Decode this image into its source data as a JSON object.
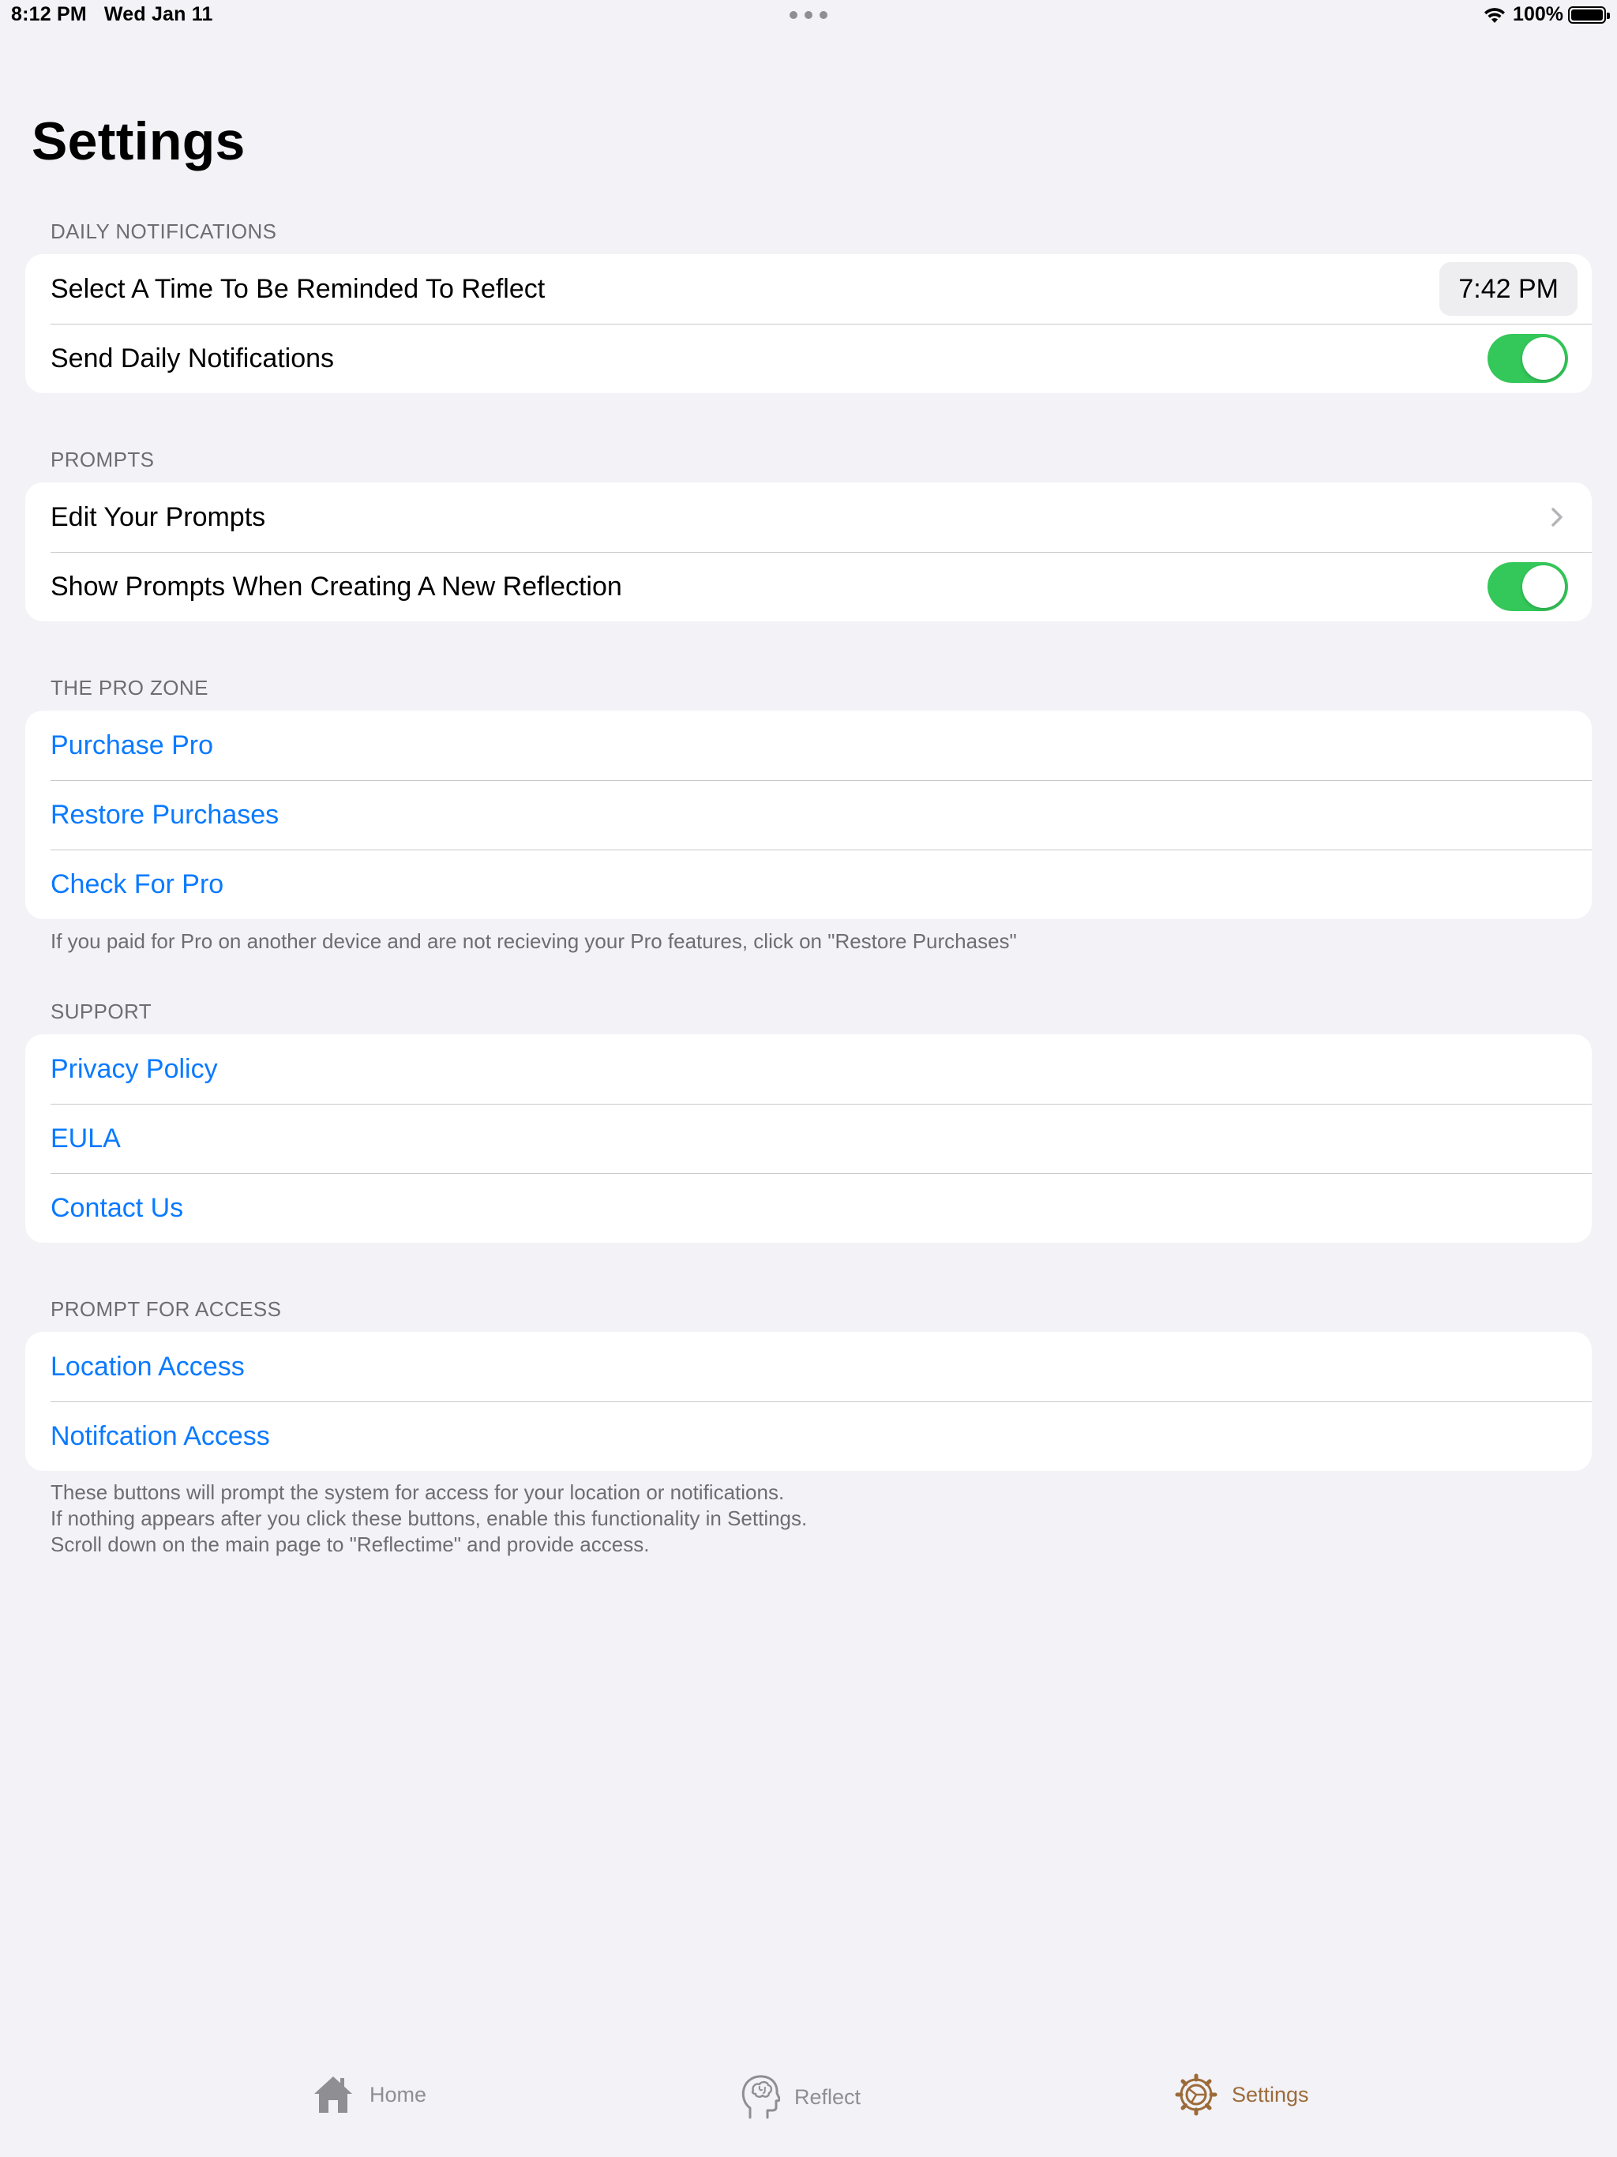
{
  "status_bar": {
    "time": "8:12 PM",
    "date": "Wed Jan 11",
    "battery": "100%"
  },
  "page_title": "Settings",
  "sections": {
    "daily_notifications": {
      "header": "DAILY NOTIFICATIONS",
      "reminder_label": "Select A Time To Be Reminded To Reflect",
      "reminder_time": "7:42 PM",
      "send_label": "Send Daily Notifications",
      "send_enabled": true
    },
    "prompts": {
      "header": "PROMPTS",
      "edit_label": "Edit Your Prompts",
      "show_label": "Show Prompts When Creating A New Reflection",
      "show_enabled": true
    },
    "pro_zone": {
      "header": "THE PRO ZONE",
      "items": [
        "Purchase Pro",
        "Restore Purchases",
        "Check For Pro"
      ],
      "footer": "If you paid for Pro on another device and are not recieving your Pro features, click on \"Restore Purchases\""
    },
    "support": {
      "header": "SUPPORT",
      "items": [
        "Privacy Policy",
        "EULA",
        "Contact Us"
      ]
    },
    "access": {
      "header": "PROMPT FOR ACCESS",
      "items": [
        "Location Access",
        "Notifcation Access"
      ],
      "footer_lines": [
        "These buttons will prompt the system for access for your location or notifications.",
        "If nothing appears after you click these buttons,  enable this functionality in Settings.",
        "Scroll down on the main page to \"Reflectime\" and provide access."
      ]
    }
  },
  "tab_bar": {
    "tabs": [
      {
        "label": "Home",
        "icon": "house-icon"
      },
      {
        "label": "Reflect",
        "icon": "brain-head-icon"
      },
      {
        "label": "Settings",
        "icon": "gear-icon",
        "selected": true
      }
    ]
  },
  "colors": {
    "background": "#f2f2f7",
    "link": "#0a7aff",
    "toggle_on": "#34c759",
    "tab_selected": "#9c6b3a",
    "tab_unselected": "#8e8e93"
  }
}
